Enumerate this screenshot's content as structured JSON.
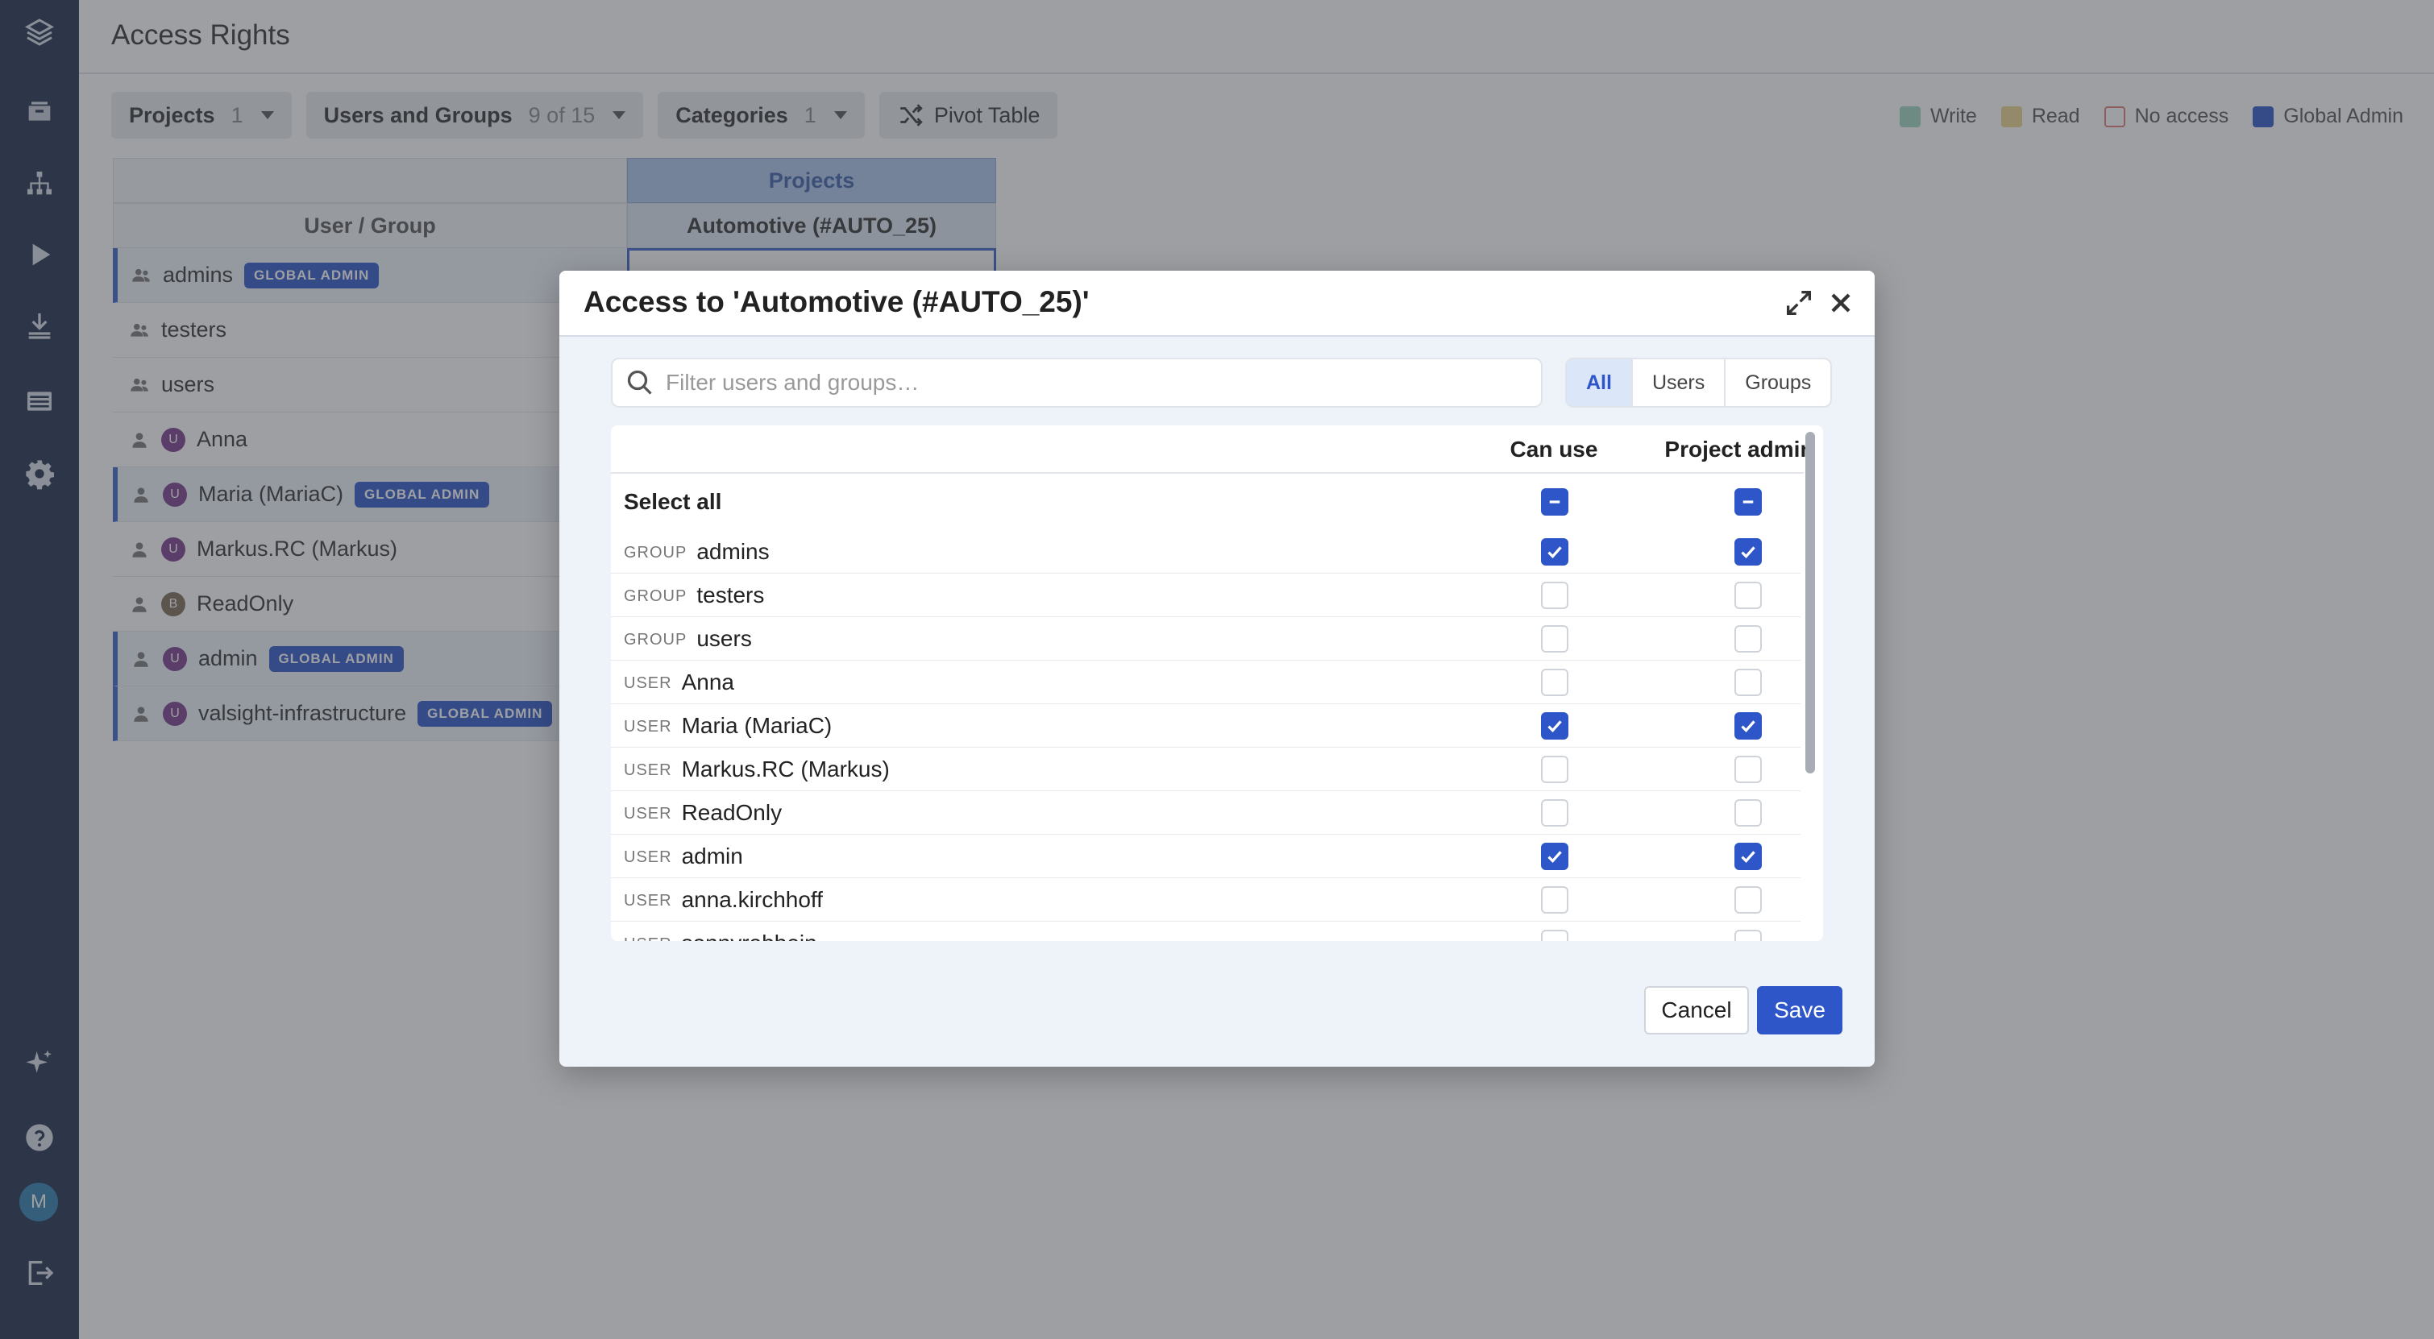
{
  "page": {
    "title": "Access Rights"
  },
  "toolbar": {
    "projects_label": "Projects",
    "projects_count": "1",
    "users_label": "Users and Groups",
    "users_count": "9 of 15",
    "categories_label": "Categories",
    "categories_count": "1",
    "pivot_label": "Pivot Table"
  },
  "legend": [
    {
      "label": "Write",
      "color": "#9fd6c1"
    },
    {
      "label": "Read",
      "color": "#e8d48a"
    },
    {
      "label": "No access",
      "color": "#ffffff",
      "border": "#e07a7a"
    },
    {
      "label": "Global Admin",
      "color": "#2f56c9"
    }
  ],
  "grid": {
    "projects_header": "Projects",
    "user_group_header": "User / Group",
    "project_column": "Automotive (#AUTO_25)",
    "selected_cell": "Project admin",
    "rows": [
      {
        "name": "admins",
        "type": "group",
        "badge": "GLOBAL ADMIN"
      },
      {
        "name": "testers",
        "type": "group",
        "badge": ""
      },
      {
        "name": "users",
        "type": "group",
        "badge": ""
      },
      {
        "name": "Anna",
        "type": "user",
        "avatar": "U",
        "badge": ""
      },
      {
        "name": "Maria (MariaC)",
        "type": "user",
        "avatar": "U",
        "badge": "GLOBAL ADMIN"
      },
      {
        "name": "Markus.RC (Markus)",
        "type": "user",
        "avatar": "U",
        "badge": ""
      },
      {
        "name": "ReadOnly",
        "type": "user",
        "avatar": "B",
        "badge": ""
      },
      {
        "name": "admin",
        "type": "user",
        "avatar": "U",
        "badge": "GLOBAL ADMIN"
      },
      {
        "name": "valsight-infrastructure",
        "type": "user",
        "avatar": "U",
        "badge": "GLOBAL ADMIN"
      }
    ]
  },
  "modal": {
    "title": "Access to 'Automotive (#AUTO_25)'",
    "search_placeholder": "Filter users and groups…",
    "filters": [
      "All",
      "Users",
      "Groups"
    ],
    "active_filter": "All",
    "col_can_use": "Can use",
    "col_project_admin": "Project admin",
    "select_all_label": "Select all",
    "rows": [
      {
        "kind": "GROUP",
        "name": "admins",
        "can_use": true,
        "admin": true
      },
      {
        "kind": "GROUP",
        "name": "testers",
        "can_use": false,
        "admin": false
      },
      {
        "kind": "GROUP",
        "name": "users",
        "can_use": false,
        "admin": false
      },
      {
        "kind": "USER",
        "name": "Anna",
        "can_use": false,
        "admin": false
      },
      {
        "kind": "USER",
        "name": "Maria (MariaC)",
        "can_use": true,
        "admin": true
      },
      {
        "kind": "USER",
        "name": "Markus.RC (Markus)",
        "can_use": false,
        "admin": false
      },
      {
        "kind": "USER",
        "name": "ReadOnly",
        "can_use": false,
        "admin": false
      },
      {
        "kind": "USER",
        "name": "admin",
        "can_use": true,
        "admin": true
      },
      {
        "kind": "USER",
        "name": "anna.kirchhoff",
        "can_use": false,
        "admin": false
      },
      {
        "kind": "USER",
        "name": "sonnyrabbein",
        "can_use": false,
        "admin": false
      }
    ],
    "cancel_label": "Cancel",
    "save_label": "Save"
  },
  "sidebar": {
    "avatar_initial": "M",
    "icons": [
      "layers-icon",
      "inbox-icon",
      "hierarchy-icon",
      "play-icon",
      "import-icon",
      "table-icon",
      "gear-icon",
      "sparkle-icon",
      "help-icon",
      "logout-icon"
    ]
  },
  "colors": {
    "sidebar": "#1d2d4a",
    "accent": "#2f56c9",
    "overlay": "rgba(60,64,70,0.5)"
  }
}
